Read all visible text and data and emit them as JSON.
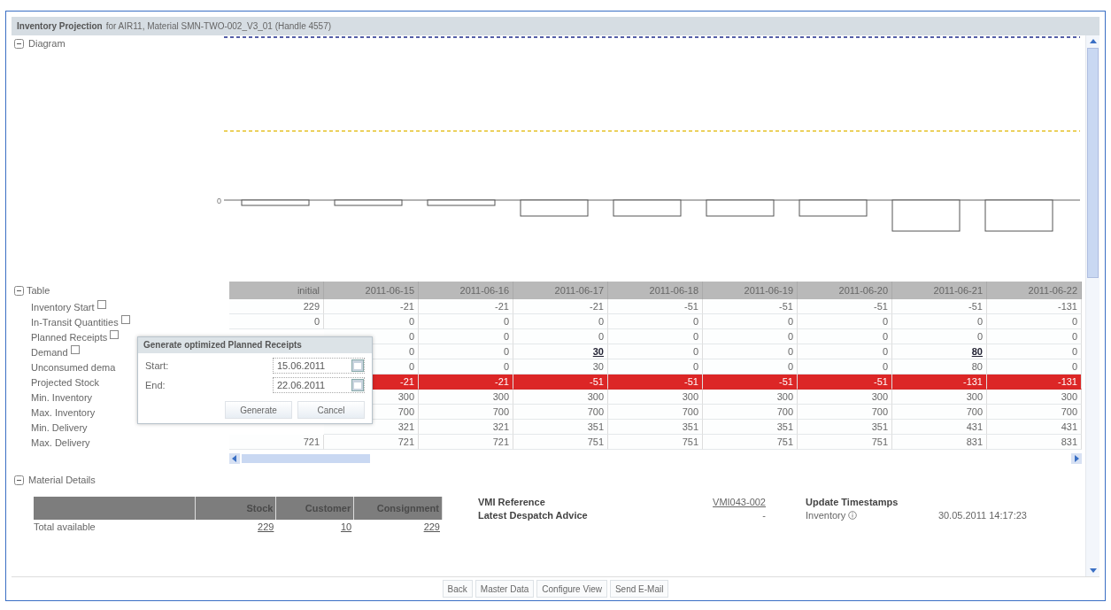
{
  "header": {
    "title_bold": "Inventory Projection",
    "title_rest": "for AIR11, Material SMN-TWO-002_V3_01 (Handle 4557)"
  },
  "diagram": {
    "label": "Diagram",
    "expanded": true,
    "axis_label": "0"
  },
  "table": {
    "label": "Table",
    "expanded": true,
    "columns": [
      "initial",
      "2011-06-15",
      "2011-06-16",
      "2011-06-17",
      "2011-06-18",
      "2011-06-19",
      "2011-06-20",
      "2011-06-21",
      "2011-06-22"
    ],
    "rows": [
      {
        "label": "Inventory Start",
        "expandable": true,
        "alert": false,
        "cells": [
          "229",
          "-21",
          "-21",
          "-21",
          "-51",
          "-51",
          "-51",
          "-51",
          "-131"
        ]
      },
      {
        "label": "In-Transit Quantities",
        "expandable": true,
        "alert": false,
        "cells": [
          "0",
          "0",
          "0",
          "0",
          "0",
          "0",
          "0",
          "0",
          "0"
        ]
      },
      {
        "label": "Planned Receipts",
        "expandable": true,
        "alert": false,
        "cells": [
          null,
          "0",
          "0",
          "0",
          "0",
          "0",
          "0",
          "0",
          "0"
        ]
      },
      {
        "label": "Demand",
        "expandable": true,
        "alert": false,
        "cells": [
          null,
          {
            "value": "0",
            "link": false
          },
          {
            "value": "0",
            "link": false
          },
          {
            "value": "30",
            "link": true
          },
          {
            "value": "0",
            "link": false
          },
          {
            "value": "0",
            "link": false
          },
          {
            "value": "0",
            "link": false
          },
          {
            "value": "80",
            "link": true
          },
          {
            "value": "0",
            "link": false
          }
        ]
      },
      {
        "label": "Unconsumed dema",
        "expandable": false,
        "alert": false,
        "cells": [
          null,
          "0",
          "0",
          "30",
          "0",
          "0",
          "0",
          "80",
          "0"
        ]
      },
      {
        "label": "Projected Stock",
        "expandable": false,
        "alert": true,
        "cells": [
          null,
          "-21",
          "-21",
          "-51",
          "-51",
          "-51",
          "-51",
          "-131",
          "-131"
        ]
      },
      {
        "label": "Min. Inventory",
        "expandable": false,
        "alert": false,
        "cells": [
          null,
          "300",
          "300",
          "300",
          "300",
          "300",
          "300",
          "300",
          "300"
        ]
      },
      {
        "label": "Max. Inventory",
        "expandable": false,
        "alert": false,
        "cells": [
          null,
          "700",
          "700",
          "700",
          "700",
          "700",
          "700",
          "700",
          "700"
        ]
      },
      {
        "label": "Min. Delivery",
        "expandable": false,
        "alert": false,
        "cells": [
          null,
          "321",
          "321",
          "351",
          "351",
          "351",
          "351",
          "431",
          "431"
        ]
      },
      {
        "label": "Max. Delivery",
        "expandable": false,
        "alert": false,
        "cells": [
          "721",
          "721",
          "721",
          "751",
          "751",
          "751",
          "751",
          "831",
          "831"
        ]
      }
    ]
  },
  "dialog": {
    "title": "Generate optimized Planned Receipts",
    "fields": [
      {
        "label": "Start:",
        "value": "15.06.2011"
      },
      {
        "label": "End:",
        "value": "22.06.2011"
      }
    ],
    "buttons": [
      "Generate",
      "Cancel"
    ]
  },
  "material_details": {
    "label": "Material Details",
    "expanded": true,
    "stock_table": {
      "columns": [
        "Stock",
        "Customer",
        "Consignment"
      ],
      "row_label": "Total available",
      "values": [
        "229",
        "10",
        "229"
      ]
    },
    "vmi": [
      {
        "label": "VMI Reference",
        "value": "VMI043-002",
        "link": true
      },
      {
        "label": "Latest Despatch Advice",
        "value": "-",
        "link": false
      }
    ],
    "timestamps": {
      "title": "Update Timestamps",
      "items": [
        {
          "label": "Inventory",
          "value": "30.05.2011 14:17:23"
        }
      ]
    }
  },
  "buttons": [
    "Back",
    "Master Data",
    "Configure View",
    "Send E-Mail"
  ]
}
